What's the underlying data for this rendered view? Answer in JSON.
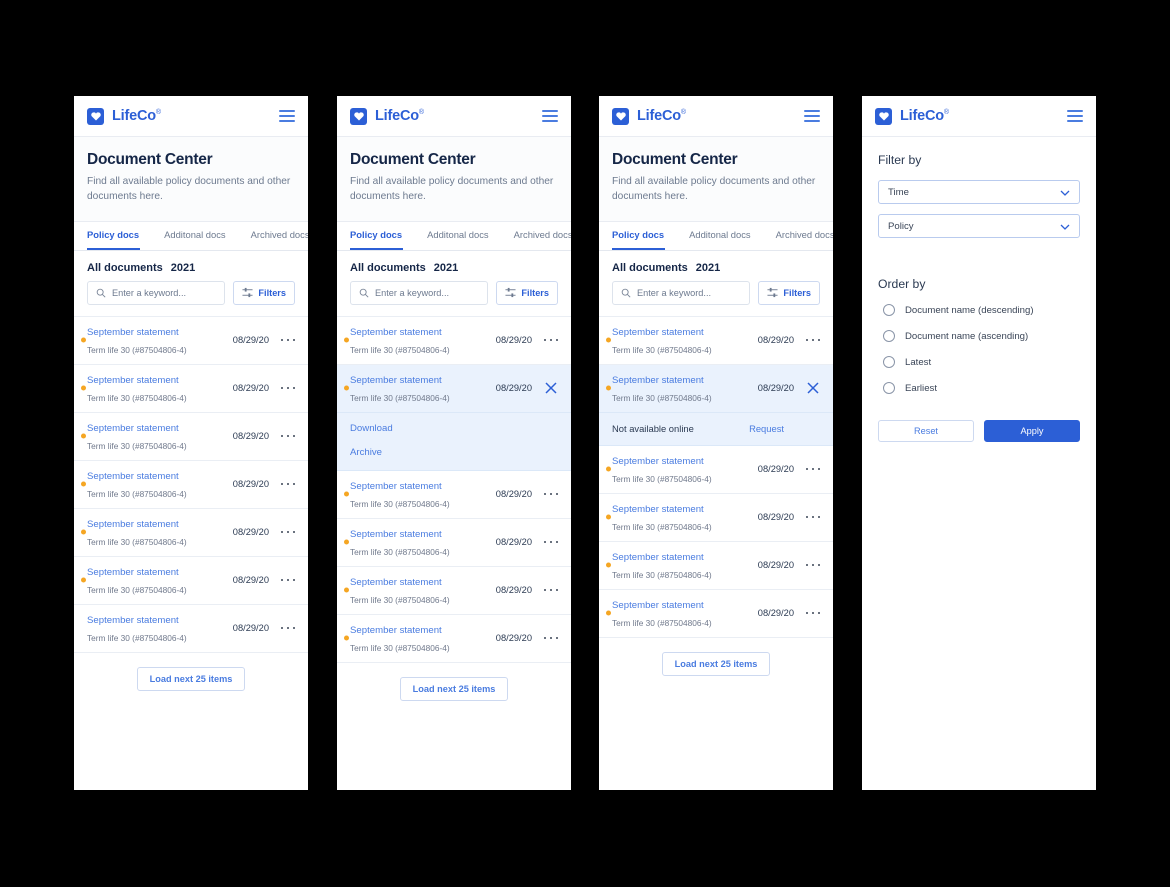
{
  "header": {
    "brand": "LifeCo",
    "brand_sup": "®",
    "menu_icon": "hamburger-icon"
  },
  "page": {
    "title": "Document Center",
    "subtitle": "Find all available policy documents and other documents here."
  },
  "tabs": [
    {
      "label": "Policy docs",
      "active": true
    },
    {
      "label": "Additonal docs",
      "active": false
    },
    {
      "label": "Archived docs",
      "active": false
    }
  ],
  "list_header": {
    "all_label": "All documents",
    "year": "2021"
  },
  "search": {
    "placeholder": "Enter a keyword...",
    "value": ""
  },
  "filters_button": {
    "label": "Filters"
  },
  "document": {
    "title": "September statement",
    "subtitle": "Term life 30 (#87504806-4)",
    "date": "08/29/20"
  },
  "actions": {
    "download": "Download",
    "archive": "Archive",
    "not_available": "Not available online",
    "request": "Request"
  },
  "load_more": {
    "label": "Load next 25 items"
  },
  "filter_panel": {
    "filter_by_title": "Filter by",
    "selects": [
      {
        "name": "time-select",
        "value": "Time"
      },
      {
        "name": "policy-select",
        "value": "Policy"
      }
    ],
    "order_by_title": "Order by",
    "order_options": [
      {
        "label": "Document name (descending)",
        "selected": false
      },
      {
        "label": "Document name (ascending)",
        "selected": false
      },
      {
        "label": "Latest",
        "selected": false
      },
      {
        "label": "Earliest",
        "selected": false
      }
    ],
    "reset_label": "Reset",
    "apply_label": "Apply"
  },
  "colors": {
    "brand_blue": "#2c5fd6",
    "link_blue": "#4a7ce0",
    "dot_orange": "#f5a623",
    "selected_row_bg": "#eaf2fd",
    "title_navy": "#152647"
  },
  "panels": [
    {
      "name": "panel-list-default",
      "rows": 7,
      "state": "default"
    },
    {
      "name": "panel-row-expanded",
      "rows": 6,
      "state": "expanded-actions"
    },
    {
      "name": "panel-row-unavailable",
      "rows": 6,
      "state": "expanded-request"
    },
    {
      "name": "panel-filter",
      "rows": 0,
      "state": "filter"
    }
  ]
}
